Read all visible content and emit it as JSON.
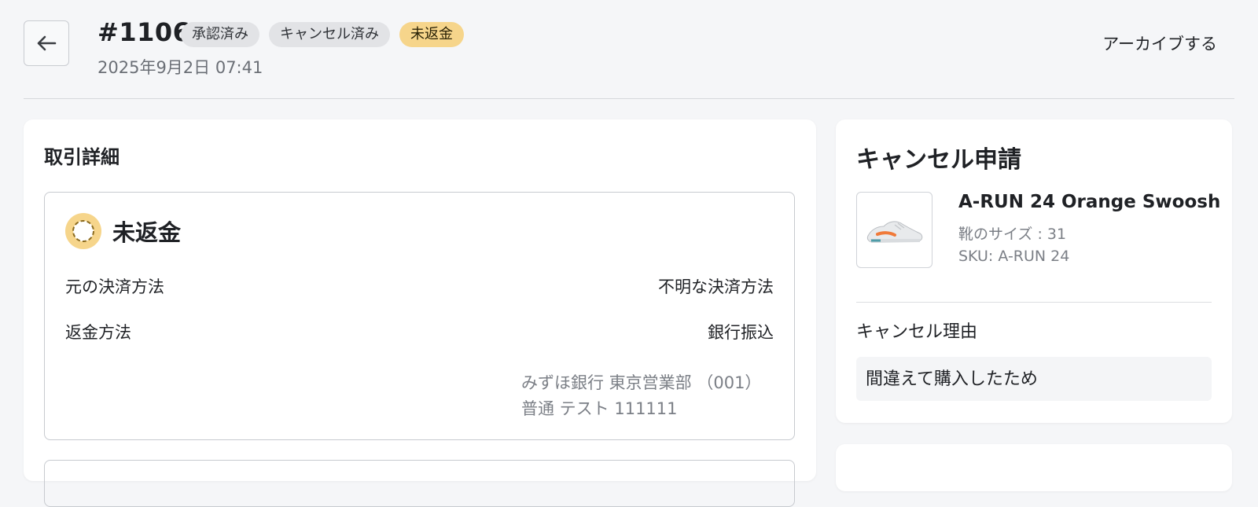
{
  "header": {
    "order_number": "#1106",
    "badges": [
      "承認済み",
      "キャンセル済み",
      "未返金"
    ],
    "date": "2025年9月2日 07:41",
    "archive_label": "アーカイブする"
  },
  "transaction": {
    "title": "取引詳細",
    "status_label": "未返金",
    "rows": [
      {
        "label": "元の決済方法",
        "value": "不明な決済方法"
      },
      {
        "label": "返金方法",
        "value": "銀行振込"
      }
    ],
    "bank_line1": "みずほ銀行 東京営業部 （001）",
    "bank_line2": "普通 テスト 111111"
  },
  "cancel_request": {
    "title": "キャンセル申請",
    "product_name": "A-RUN 24 Orange Swoosh",
    "size": "靴のサイズ : 31",
    "sku": "SKU: A-RUN 24",
    "reason_label": "キャンセル理由",
    "reason": "間違えて購入したため"
  },
  "colors": {
    "warning": "#f6d58b",
    "badge_gray": "#e2e3e6",
    "accent_orange": "#f07a3a"
  }
}
